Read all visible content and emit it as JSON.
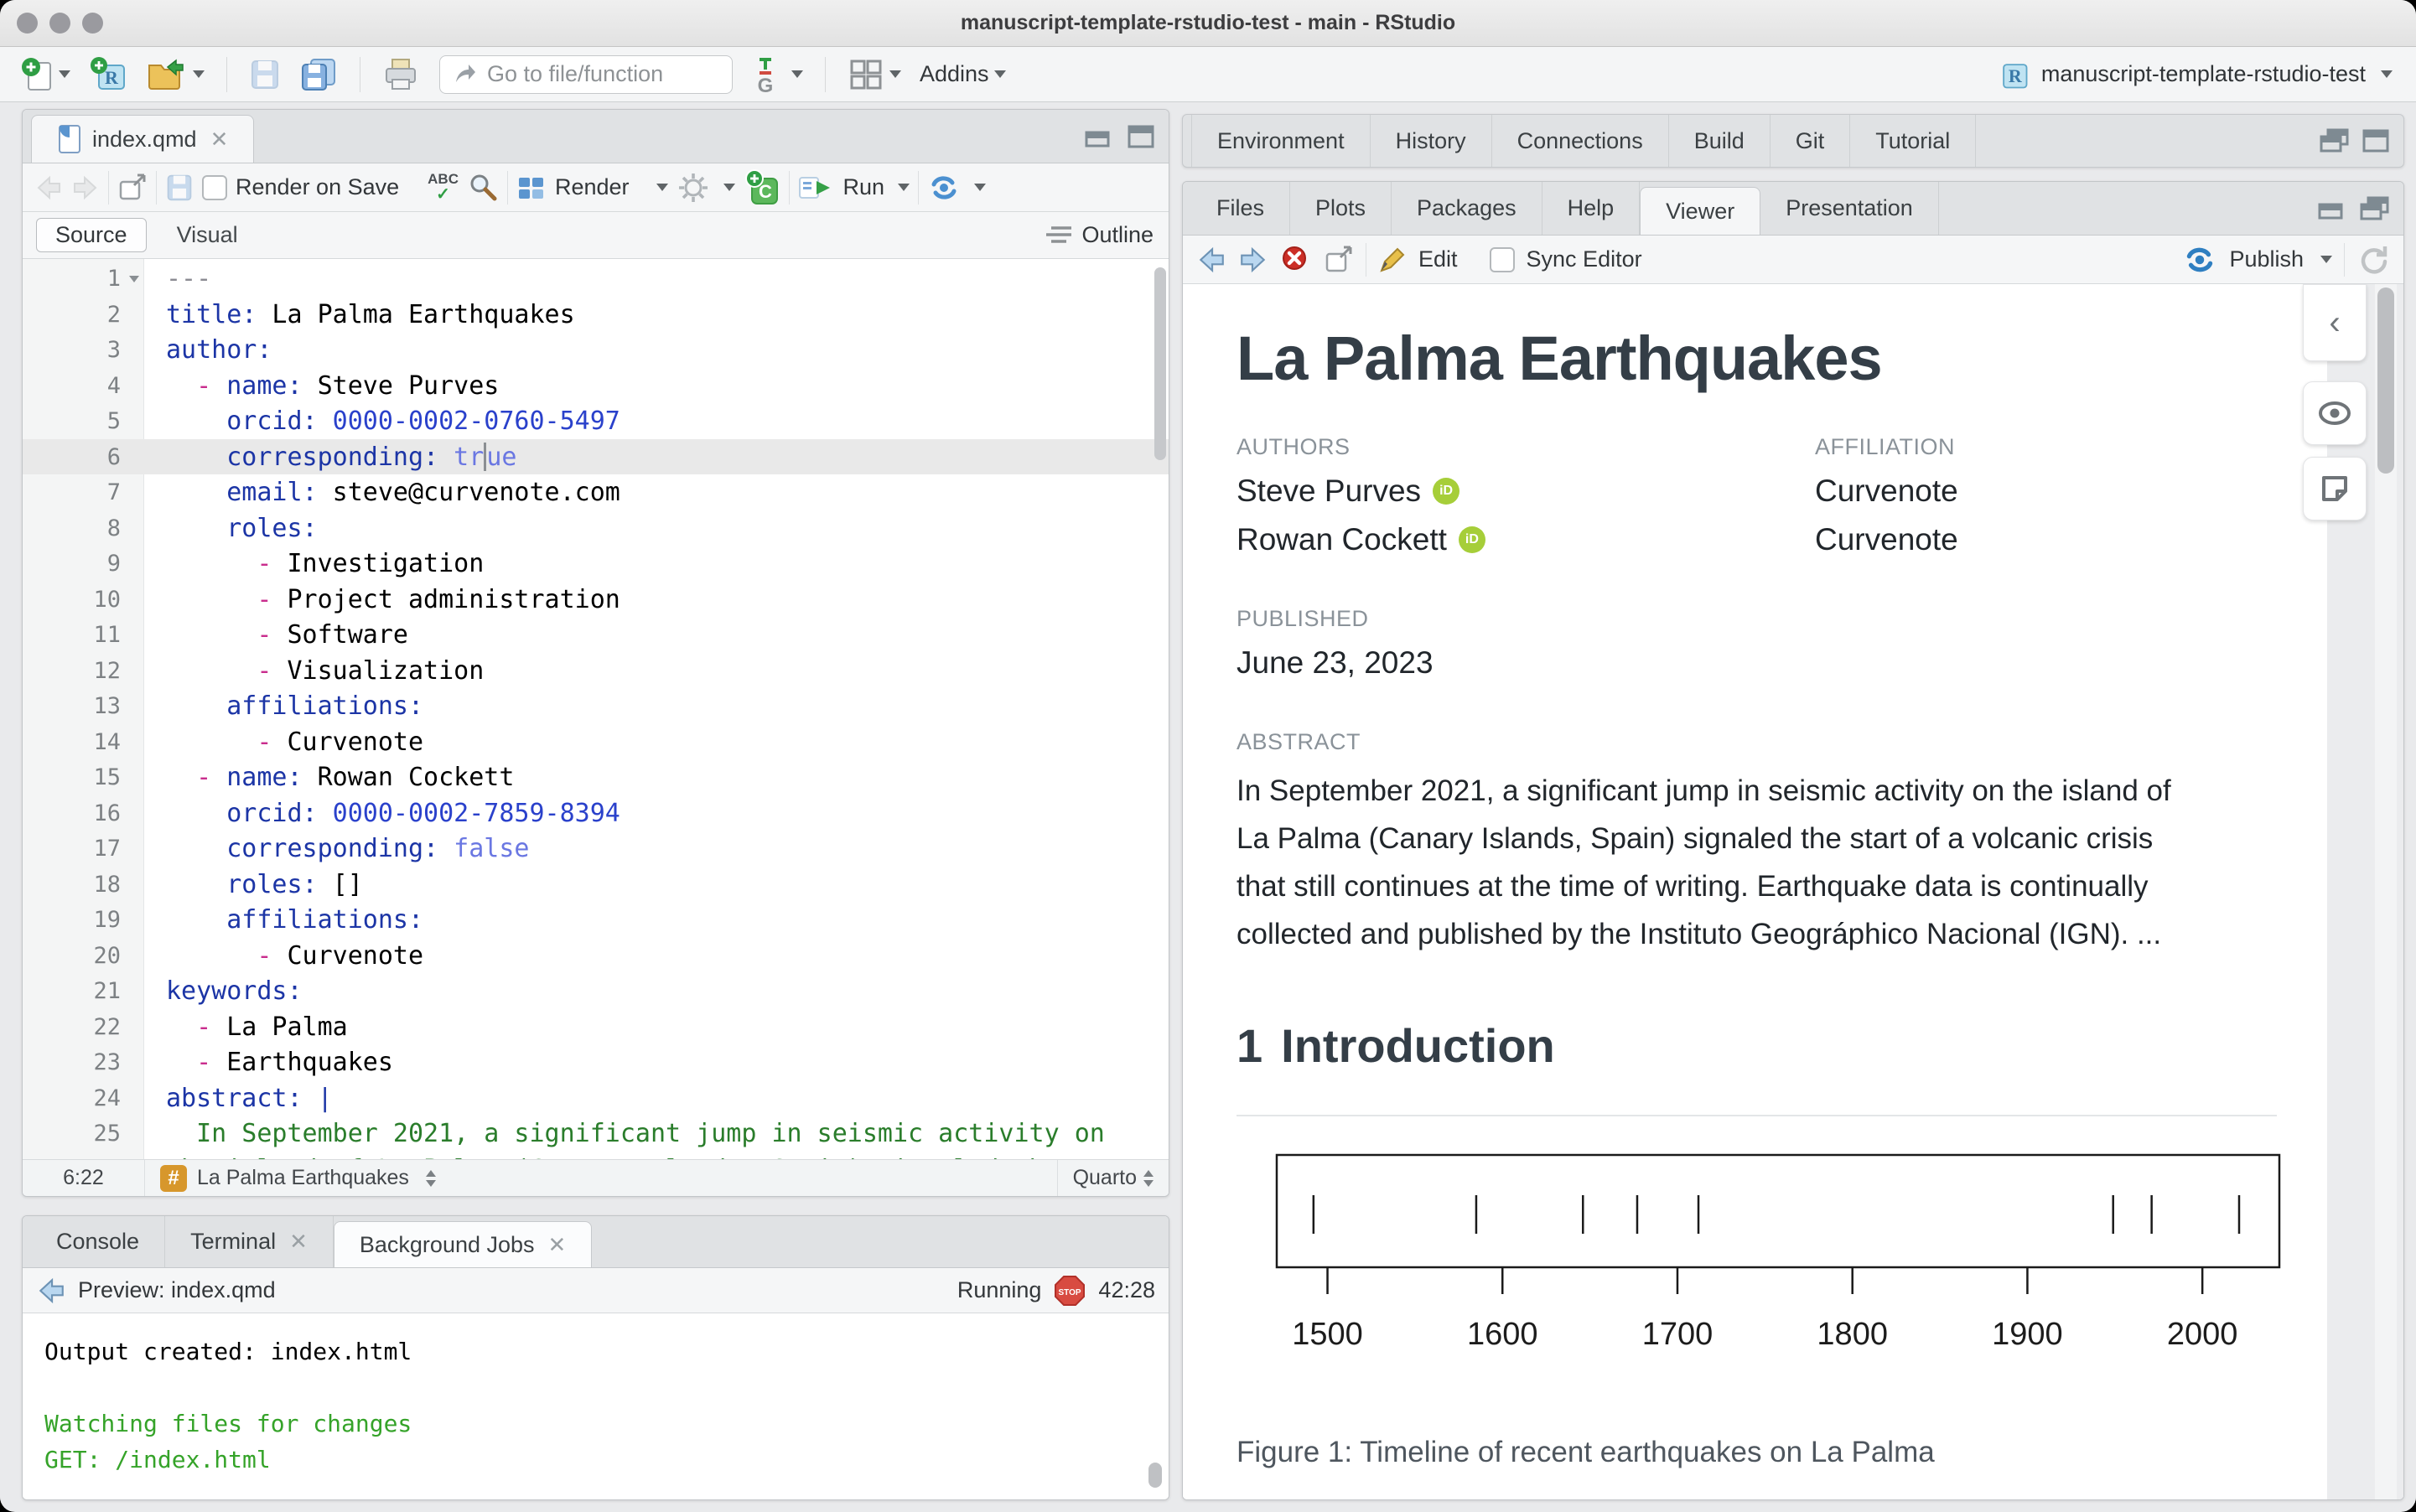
{
  "window": {
    "title": "manuscript-template-rstudio-test - main - RStudio"
  },
  "main_toolbar": {
    "goto_placeholder": "Go to file/function",
    "addins_label": "Addins",
    "project_name": "manuscript-template-rstudio-test"
  },
  "editor": {
    "tab": "index.qmd",
    "toolbar": {
      "render_on_save": "Render on Save",
      "render": "Render",
      "run": "Run"
    },
    "mode": {
      "source": "Source",
      "visual": "Visual",
      "outline": "Outline"
    },
    "status": {
      "position": "6:22",
      "section": "La Palma Earthquakes",
      "format": "Quarto"
    },
    "lines": [
      {
        "n": "1",
        "fold": true,
        "tokens": [
          [
            "cm",
            "---"
          ]
        ]
      },
      {
        "n": "2",
        "tokens": [
          [
            "k",
            "title:"
          ],
          [
            "t",
            " La Palma Earthquakes"
          ]
        ]
      },
      {
        "n": "3",
        "tokens": [
          [
            "k",
            "author:"
          ]
        ]
      },
      {
        "n": "4",
        "tokens": [
          [
            "t",
            "  "
          ],
          [
            "d",
            "- "
          ],
          [
            "k",
            "name:"
          ],
          [
            "t",
            " Steve Purves"
          ]
        ]
      },
      {
        "n": "5",
        "tokens": [
          [
            "t",
            "    "
          ],
          [
            "k",
            "orcid:"
          ],
          [
            "n",
            " 0000-0002-0760-5497"
          ]
        ]
      },
      {
        "n": "6",
        "current": true,
        "tokens": [
          [
            "t",
            "    "
          ],
          [
            "k",
            "corresponding:"
          ],
          [
            "b",
            " tr"
          ],
          [
            "cursor",
            ""
          ],
          [
            "b",
            "ue"
          ]
        ]
      },
      {
        "n": "7",
        "tokens": [
          [
            "t",
            "    "
          ],
          [
            "k",
            "email:"
          ],
          [
            "t",
            " steve@curvenote.com"
          ]
        ]
      },
      {
        "n": "8",
        "tokens": [
          [
            "t",
            "    "
          ],
          [
            "k",
            "roles:"
          ]
        ]
      },
      {
        "n": "9",
        "tokens": [
          [
            "t",
            "      "
          ],
          [
            "d",
            "- "
          ],
          [
            "t",
            "Investigation"
          ]
        ]
      },
      {
        "n": "10",
        "tokens": [
          [
            "t",
            "      "
          ],
          [
            "d",
            "- "
          ],
          [
            "t",
            "Project administration"
          ]
        ]
      },
      {
        "n": "11",
        "tokens": [
          [
            "t",
            "      "
          ],
          [
            "d",
            "- "
          ],
          [
            "t",
            "Software"
          ]
        ]
      },
      {
        "n": "12",
        "tokens": [
          [
            "t",
            "      "
          ],
          [
            "d",
            "- "
          ],
          [
            "t",
            "Visualization"
          ]
        ]
      },
      {
        "n": "13",
        "tokens": [
          [
            "t",
            "    "
          ],
          [
            "k",
            "affiliations:"
          ]
        ]
      },
      {
        "n": "14",
        "tokens": [
          [
            "t",
            "      "
          ],
          [
            "d",
            "- "
          ],
          [
            "t",
            "Curvenote"
          ]
        ]
      },
      {
        "n": "15",
        "tokens": [
          [
            "t",
            "  "
          ],
          [
            "d",
            "- "
          ],
          [
            "k",
            "name:"
          ],
          [
            "t",
            " Rowan Cockett"
          ]
        ]
      },
      {
        "n": "16",
        "tokens": [
          [
            "t",
            "    "
          ],
          [
            "k",
            "orcid:"
          ],
          [
            "n",
            " 0000-0002-7859-8394"
          ]
        ]
      },
      {
        "n": "17",
        "tokens": [
          [
            "t",
            "    "
          ],
          [
            "k",
            "corresponding:"
          ],
          [
            "b",
            " false"
          ]
        ]
      },
      {
        "n": "18",
        "tokens": [
          [
            "t",
            "    "
          ],
          [
            "k",
            "roles:"
          ],
          [
            "t",
            " []"
          ]
        ]
      },
      {
        "n": "19",
        "tokens": [
          [
            "t",
            "    "
          ],
          [
            "k",
            "affiliations:"
          ]
        ]
      },
      {
        "n": "20",
        "tokens": [
          [
            "t",
            "      "
          ],
          [
            "d",
            "- "
          ],
          [
            "t",
            "Curvenote"
          ]
        ]
      },
      {
        "n": "21",
        "tokens": [
          [
            "k",
            "keywords:"
          ]
        ]
      },
      {
        "n": "22",
        "tokens": [
          [
            "t",
            "  "
          ],
          [
            "d",
            "- "
          ],
          [
            "t",
            "La Palma"
          ]
        ]
      },
      {
        "n": "23",
        "tokens": [
          [
            "t",
            "  "
          ],
          [
            "d",
            "- "
          ],
          [
            "t",
            "Earthquakes"
          ]
        ]
      },
      {
        "n": "24",
        "tokens": [
          [
            "k",
            "abstract:"
          ],
          [
            "t",
            " "
          ],
          [
            "k",
            "|"
          ]
        ]
      },
      {
        "n": "25",
        "tokens": [
          [
            "g",
            "  In September 2021, a significant jump in seismic activity on"
          ]
        ]
      },
      {
        "n": "",
        "tokens": [
          [
            "g",
            "the island of La Palma (Canary Islands, Spain) signaled the start"
          ]
        ]
      }
    ]
  },
  "console": {
    "tabs": [
      {
        "label": "Console",
        "closable": false,
        "active": false
      },
      {
        "label": "Terminal",
        "closable": true,
        "active": false
      },
      {
        "label": "Background Jobs",
        "closable": true,
        "active": true
      }
    ],
    "toolbar": {
      "label": "Preview: index.qmd",
      "status": "Running",
      "time": "42:28"
    },
    "output": [
      {
        "text": "Output created: index.html",
        "cls": "black"
      },
      {
        "text": "",
        "cls": "black"
      },
      {
        "text": "Watching files for changes",
        "cls": "green"
      },
      {
        "text": "GET: /index.html",
        "cls": "green"
      }
    ]
  },
  "right": {
    "top_tabs": [
      {
        "label": "Environment"
      },
      {
        "label": "History"
      },
      {
        "label": "Connections"
      },
      {
        "label": "Build"
      },
      {
        "label": "Git"
      },
      {
        "label": "Tutorial"
      }
    ],
    "viewer_tabs": [
      {
        "label": "Files"
      },
      {
        "label": "Plots"
      },
      {
        "label": "Packages"
      },
      {
        "label": "Help"
      },
      {
        "label": "Viewer",
        "active": true
      },
      {
        "label": "Presentation"
      }
    ],
    "viewer_toolbar": {
      "edit": "Edit",
      "sync": "Sync Editor",
      "publish": "Publish"
    }
  },
  "document": {
    "title": "La Palma Earthquakes",
    "authors_label": "AUTHORS",
    "affiliation_label": "AFFILIATION",
    "authors": [
      {
        "name": "Steve Purves",
        "orcid": "iD",
        "affiliation": "Curvenote"
      },
      {
        "name": "Rowan Cockett",
        "orcid": "iD",
        "affiliation": "Curvenote"
      }
    ],
    "published_label": "PUBLISHED",
    "published": "June 23, 2023",
    "abstract_label": "ABSTRACT",
    "abstract_lines": [
      "In September 2021, a significant jump in seismic activity on the island of",
      "La Palma (Canary Islands, Spain) signaled the start of a volcanic crisis",
      "that still continues at the time of writing. Earthquake data is continually",
      "collected and published by the Instituto Geográphico Nacional (IGN). ..."
    ],
    "section_number": "1",
    "section_title": "Introduction"
  },
  "chart_data": {
    "type": "scatter",
    "subtype": "rug-timeline",
    "title": "Timeline of recent earthquakes on La Palma",
    "caption": "Figure 1: Timeline of recent earthquakes on La Palma",
    "x_values": [
      1492,
      1585,
      1646,
      1677,
      1712,
      1949,
      1971,
      2021
    ],
    "x_ticks": [
      1500,
      1600,
      1700,
      1800,
      1900,
      2000
    ],
    "xlim": [
      1471,
      2044
    ],
    "xlabel": "",
    "ylabel": "",
    "grid": false,
    "frame": true,
    "legend": false
  }
}
